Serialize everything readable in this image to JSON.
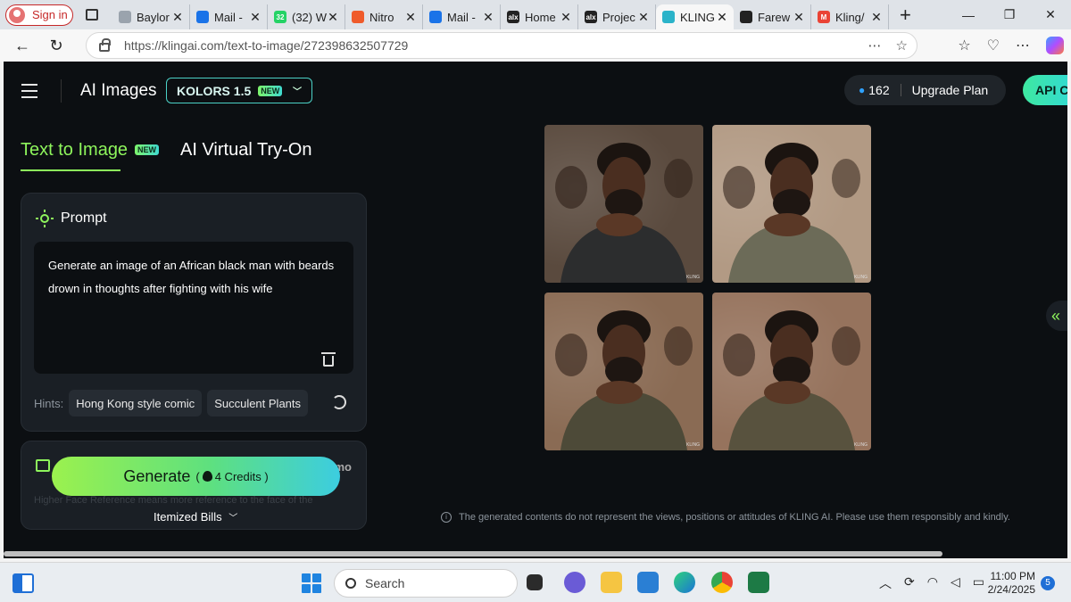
{
  "browser": {
    "signin_label": "Sign in",
    "tabs": [
      {
        "title": "Baylor",
        "icon": "baylor-icon",
        "color": "#9aa3ad"
      },
      {
        "title": "Mail -",
        "icon": "outlook-icon",
        "color": "#1a73e8"
      },
      {
        "title": "(32) W",
        "icon": "whatsapp-icon",
        "color": "#25d366",
        "fav": "32"
      },
      {
        "title": "Nitro",
        "icon": "nitro-icon",
        "color": "#ef5b2b"
      },
      {
        "title": "Mail -",
        "icon": "outlook-icon",
        "color": "#1a73e8"
      },
      {
        "title": "Home",
        "icon": "alx-icon",
        "color": "#222222",
        "fav": "alx"
      },
      {
        "title": "Projec",
        "icon": "alx-icon",
        "color": "#222222",
        "fav": "alx"
      },
      {
        "title": "KLING",
        "icon": "kling-icon",
        "color": "#2bb3c9",
        "active": true
      },
      {
        "title": "Farew",
        "icon": "openai-icon",
        "color": "#222222"
      },
      {
        "title": "Kling/",
        "icon": "gmail-icon",
        "color": "#ea4335",
        "fav": "M"
      }
    ],
    "url": "https://klingai.com/text-to-image/272398632507729"
  },
  "header": {
    "title": "AI Images",
    "model_label": "KOLORS 1.5",
    "model_badge": "NEW",
    "credits": "162",
    "upgrade_label": "Upgrade Plan",
    "api_label": "API C"
  },
  "tabs": {
    "text_to_image": "Text to Image",
    "text_to_image_badge": "NEW",
    "virtual_tryon": "AI Virtual Try-On"
  },
  "prompt": {
    "heading": "Prompt",
    "text": "Generate an image of an African black man with beards drown in thoughts after fighting with his wife",
    "hints_label": "Hints:",
    "hints": [
      "Hong Kong style comic",
      "Succulent Plants"
    ]
  },
  "reference": {
    "suffix": "mo",
    "faint_text": "Higher Face Reference means more reference to the face of the"
  },
  "generate": {
    "label": "Generate",
    "open_paren": "(",
    "credits_text": "4 Credits )"
  },
  "itemized_label": "Itemized Bills",
  "results": {
    "watermark": "KLING",
    "images": [
      {
        "name": "result-image-1",
        "bg": "#5a4a3e",
        "shirt": "#2c2d2e"
      },
      {
        "name": "result-image-2",
        "bg": "#b29a84",
        "shirt": "#6c6b58"
      },
      {
        "name": "result-image-3",
        "bg": "#8a6b54",
        "shirt": "#4d4a38"
      },
      {
        "name": "result-image-4",
        "bg": "#96735d",
        "shirt": "#58523e"
      }
    ]
  },
  "disclaimer": "The generated contents do not represent the views, positions or attitudes of KLING AI. Please use them responsibly and kindly.",
  "taskbar": {
    "search_label": "Search",
    "time": "11:00 PM",
    "date": "2/24/2025",
    "notifications": "5"
  }
}
